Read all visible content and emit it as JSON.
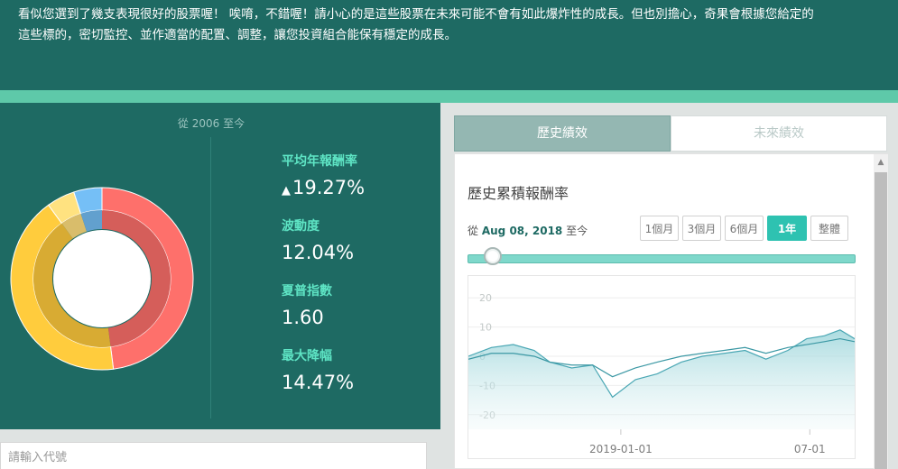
{
  "banner": {
    "line1": "看似您選到了幾支表現很好的股票喔！ 唉唷，不錯喔！請小心的是這些股票在未來可能不會有如此爆炸性的成長。但也別擔心，奇果會根據您給定的",
    "line2": "這些標的，密切監控、並作適當的配置、調整，讓您投資組合能保有穩定的成長。"
  },
  "portfolio": {
    "since_label": "從 2006 至今",
    "allocation": [
      {
        "value": 48,
        "color": "#f26b66"
      },
      {
        "value": 42,
        "color": "#f5c23a"
      },
      {
        "value": 5,
        "color": "#f7d77a"
      },
      {
        "value": 5,
        "color": "#6fb6ea"
      }
    ],
    "stats": [
      {
        "label": "平均年報酬率",
        "value": "19.27%",
        "trend": "up"
      },
      {
        "label": "波動度",
        "value": "12.04%"
      },
      {
        "label": "夏普指數",
        "value": "1.60"
      },
      {
        "label": "最大降幅",
        "value": "14.47%"
      }
    ]
  },
  "ticker_input": {
    "placeholder": "請輸入代號",
    "value": ""
  },
  "tabs": [
    {
      "label": "歷史績效",
      "active": true
    },
    {
      "label": "未來績效",
      "active": false
    }
  ],
  "performance": {
    "title": "歷史累積報酬率",
    "range_prefix": "從",
    "range_date": "Aug 08, 2018",
    "range_suffix": "至今",
    "range_buttons": [
      {
        "label": "1個月",
        "selected": false
      },
      {
        "label": "3個月",
        "selected": false
      },
      {
        "label": "6個月",
        "selected": false
      },
      {
        "label": "1年",
        "selected": true
      },
      {
        "label": "整體",
        "selected": false
      }
    ],
    "slider_value": 0.1
  },
  "chart_data": {
    "type": "area",
    "title": "",
    "ylim": [
      -25,
      25
    ],
    "yticks": [
      "20",
      "10",
      "0",
      "-10",
      "-20"
    ],
    "xticks": [
      "2019-01-01",
      "07-01"
    ],
    "xrange": [
      "2018-08-08",
      "2019-08-13"
    ],
    "series": [
      {
        "role": "portfolio",
        "x": [
          "2018-08-08",
          "2018-08-30",
          "2018-09-20",
          "2018-10-10",
          "2018-10-25",
          "2018-11-15",
          "2018-12-05",
          "2018-12-24",
          "2019-01-15",
          "2019-02-05",
          "2019-02-28",
          "2019-03-20",
          "2019-04-10",
          "2019-04-30",
          "2019-05-20",
          "2019-06-10",
          "2019-06-28",
          "2019-07-15",
          "2019-07-30",
          "2019-08-13"
        ],
        "y": [
          0,
          3,
          4,
          2,
          -2,
          -4,
          -3,
          -14,
          -8,
          -6,
          -2,
          0,
          1,
          2,
          -1,
          2,
          6,
          7,
          9,
          6
        ]
      },
      {
        "role": "benchmark",
        "x": [
          "2018-08-08",
          "2018-08-30",
          "2018-09-20",
          "2018-10-10",
          "2018-10-25",
          "2018-11-15",
          "2018-12-05",
          "2018-12-24",
          "2019-01-15",
          "2019-02-05",
          "2019-02-28",
          "2019-03-20",
          "2019-04-10",
          "2019-04-30",
          "2019-05-20",
          "2019-06-10",
          "2019-06-28",
          "2019-07-15",
          "2019-07-30",
          "2019-08-13"
        ],
        "y": [
          -1,
          1,
          1,
          0,
          -2,
          -3,
          -3,
          -7,
          -4,
          -2,
          0,
          1,
          2,
          3,
          1,
          3,
          4,
          5,
          6,
          5
        ]
      }
    ]
  }
}
